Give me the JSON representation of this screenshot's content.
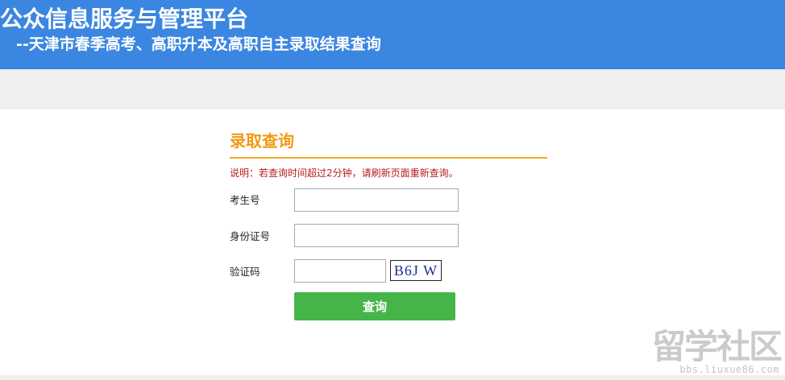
{
  "header": {
    "title": "公众信息服务与管理平台",
    "subtitle": "--天津市春季高考、高职升本及高职自主录取结果查询"
  },
  "panel": {
    "title": "录取查询",
    "notice": "说明：若查询时间超过2分钟，请刷新页面重新查询。"
  },
  "form": {
    "exam_number": {
      "label": "考生号",
      "value": ""
    },
    "id_number": {
      "label": "身份证号",
      "value": ""
    },
    "captcha": {
      "label": "验证码",
      "value": "",
      "image_text": "B6J W"
    },
    "submit_label": "查询"
  },
  "watermark": {
    "text": "留学社区",
    "url": "bbs.liuxue86.com"
  },
  "colors": {
    "header_bg": "#3b86e0",
    "title_orange": "#f19a14",
    "notice_red": "#b71c1c",
    "button_green": "#45b54a",
    "band_grey": "#f0f0f0"
  }
}
